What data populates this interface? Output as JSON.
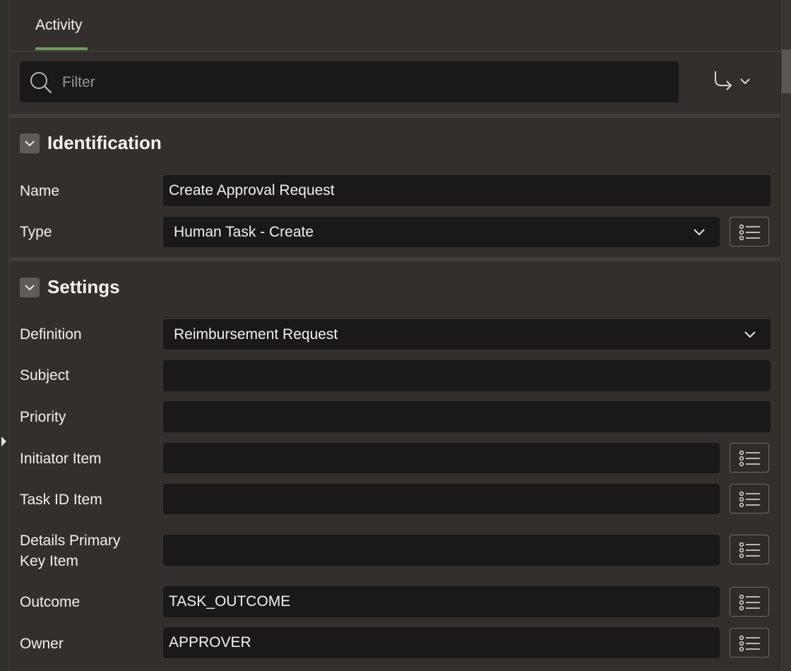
{
  "tabs": [
    {
      "label": "Activity",
      "active": true
    }
  ],
  "filter": {
    "placeholder": "Filter",
    "value": ""
  },
  "sections": {
    "identification": {
      "title": "Identification",
      "fields": {
        "name": {
          "label": "Name",
          "value": "Create Approval Request"
        },
        "type": {
          "label": "Type",
          "value": "Human Task - Create"
        }
      }
    },
    "settings": {
      "title": "Settings",
      "fields": {
        "definition": {
          "label": "Definition",
          "value": "Reimbursement Request"
        },
        "subject": {
          "label": "Subject",
          "value": ""
        },
        "priority": {
          "label": "Priority",
          "value": ""
        },
        "initiator_item": {
          "label": "Initiator Item",
          "value": ""
        },
        "task_id_item": {
          "label": "Task ID Item",
          "value": ""
        },
        "details_pk_item": {
          "label_line1": "Details Primary",
          "label_line2": "Key Item",
          "value": ""
        },
        "outcome": {
          "label": "Outcome",
          "value": "TASK_OUTCOME"
        },
        "owner": {
          "label": "Owner",
          "value": "APPROVER"
        }
      }
    }
  },
  "icons": {
    "search": "search-icon",
    "goto": "goto-arrow-icon",
    "collapse": "chevron-down-icon",
    "list": "list-icon",
    "dropdown": "chevron-down-icon"
  },
  "colors": {
    "background": "#332f2c",
    "field": "#1a1918",
    "tab_accent": "#6f9a5e",
    "text": "#f2f0ed"
  }
}
